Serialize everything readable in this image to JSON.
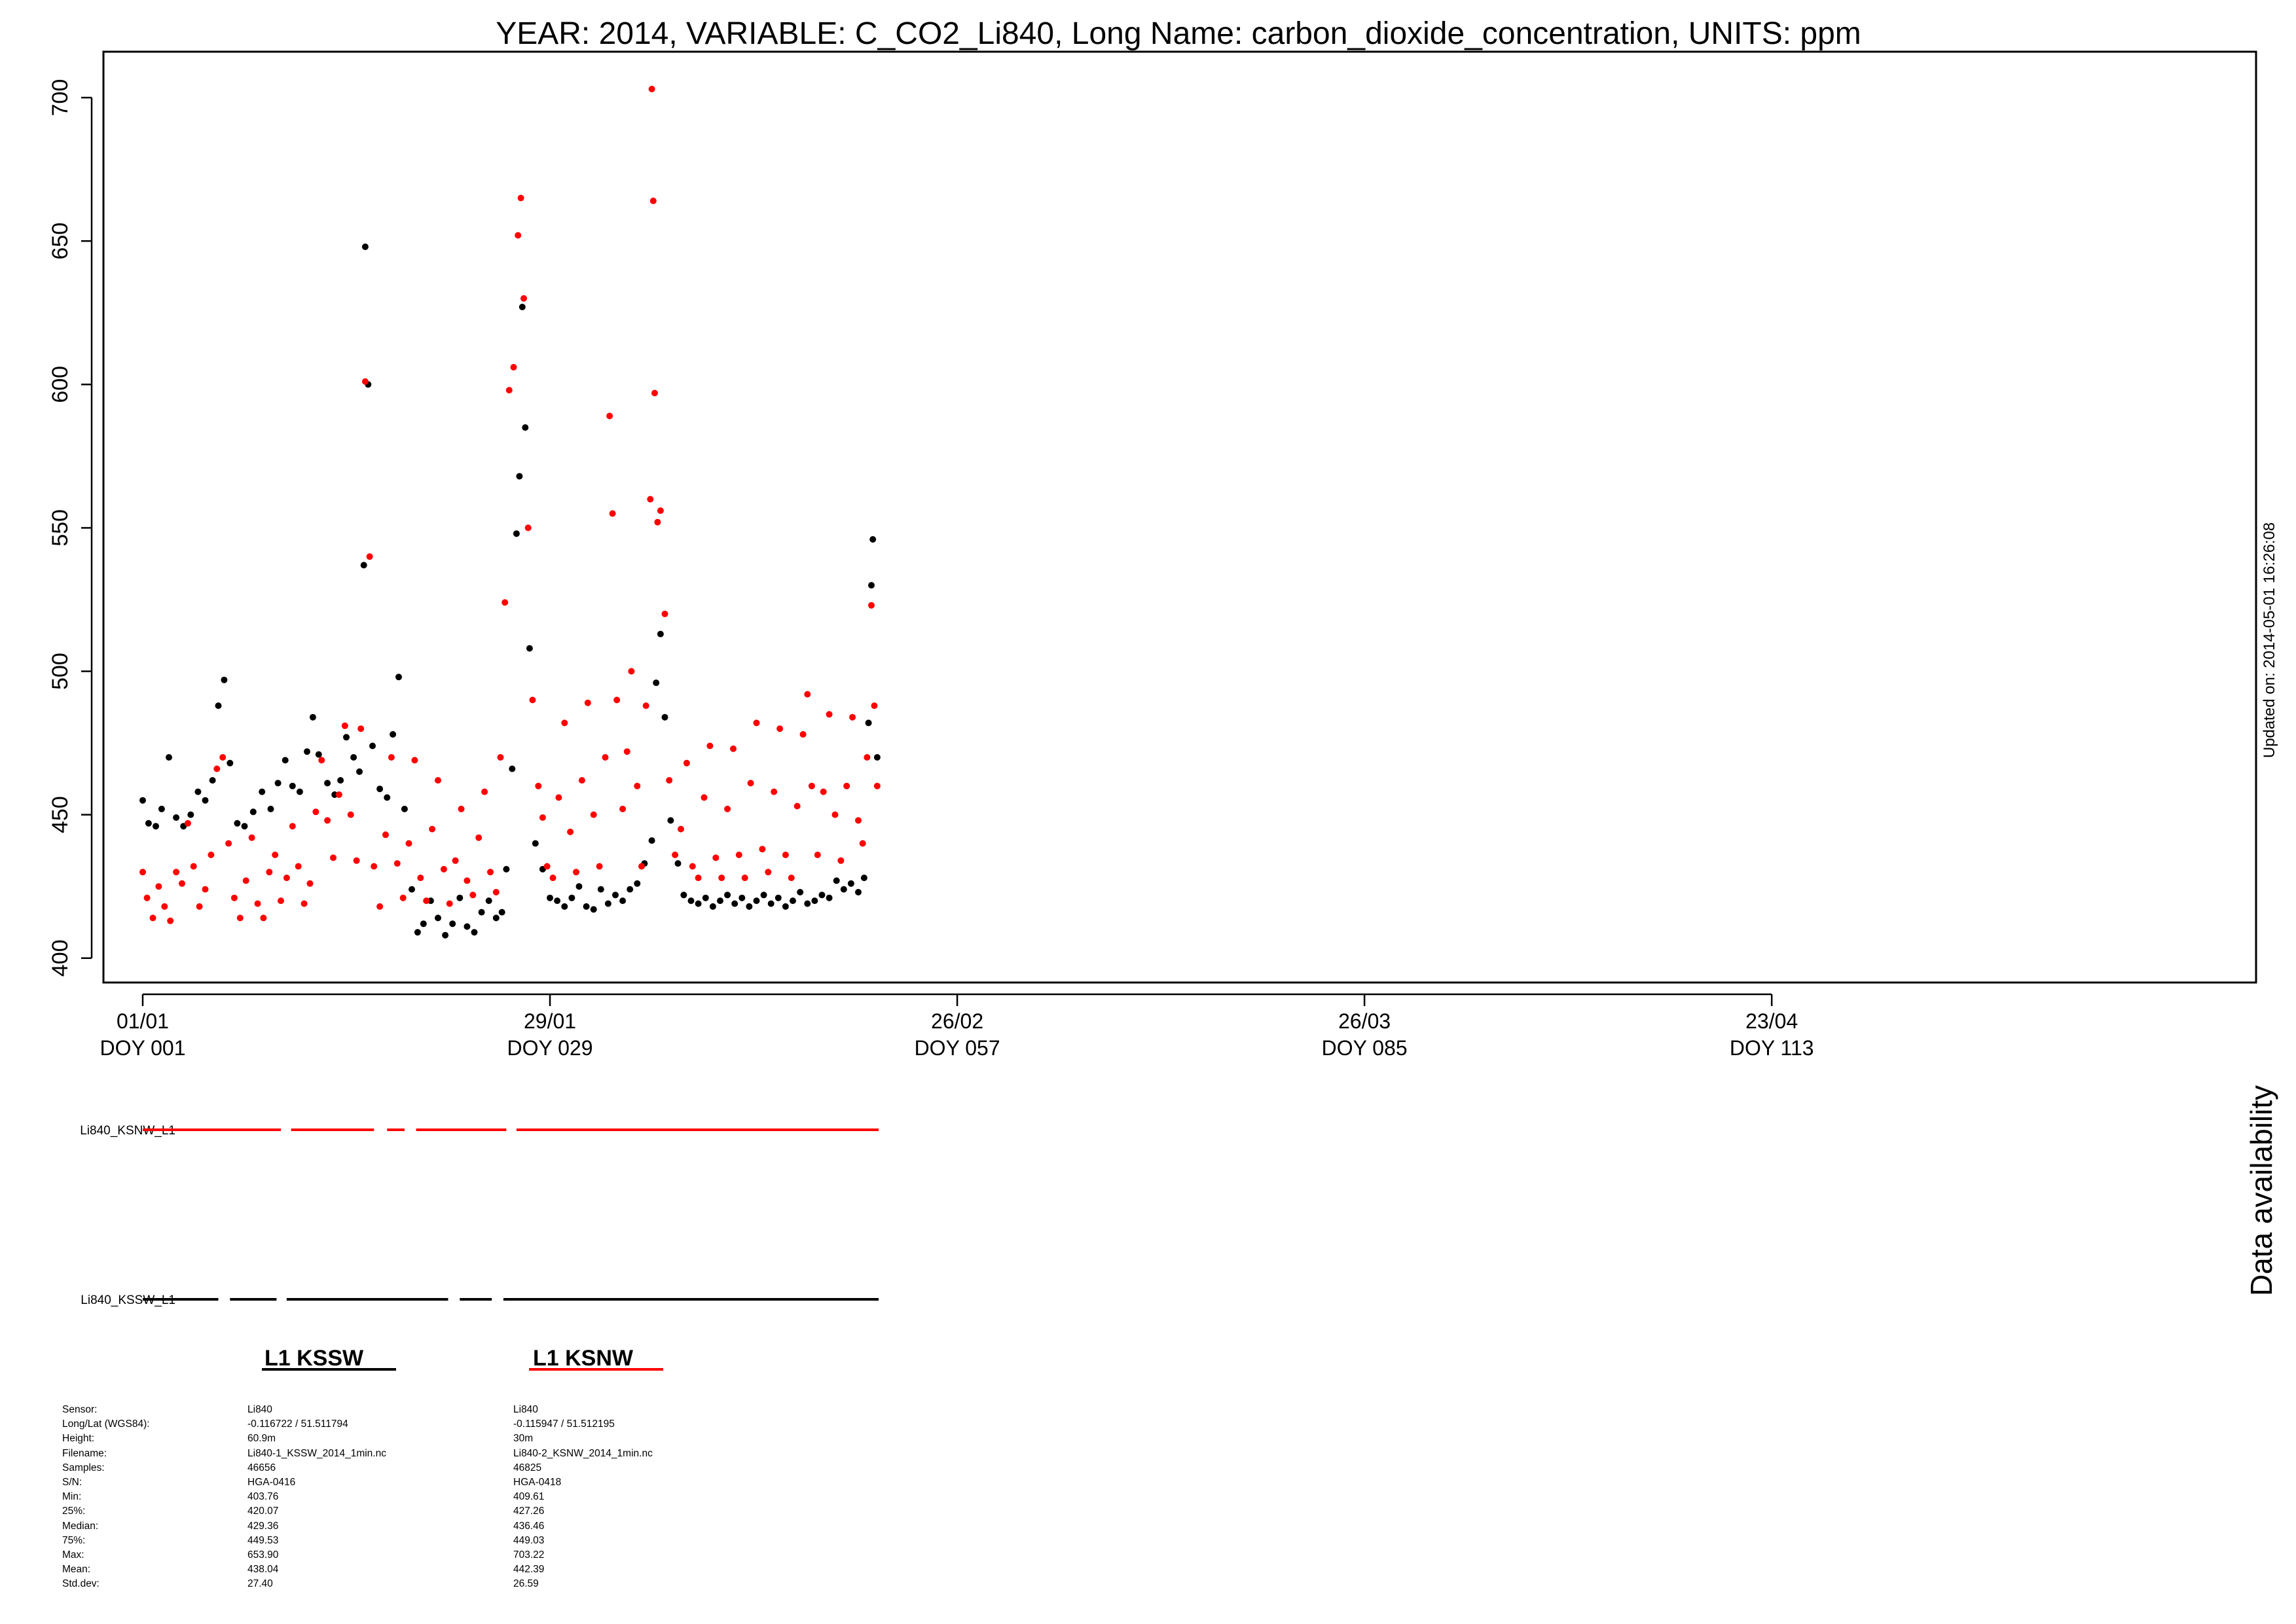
{
  "chart_data": {
    "type": "scatter",
    "title": "YEAR: 2014, VARIABLE: C_CO2_Li840, Long Name: carbon_dioxide_concentration, UNITS: ppm",
    "xlabel": "",
    "ylabel": "",
    "x_axis": {
      "unit": "day of year",
      "range": [
        -1.7,
        146.3
      ],
      "ticks": [
        {
          "doy": 1,
          "date": "01/01",
          "label": "DOY 001"
        },
        {
          "doy": 29,
          "date": "29/01",
          "label": "DOY 029"
        },
        {
          "doy": 57,
          "date": "26/02",
          "label": "DOY 057"
        },
        {
          "doy": 85,
          "date": "26/03",
          "label": "DOY 085"
        },
        {
          "doy": 113,
          "date": "23/04",
          "label": "DOY 113"
        }
      ]
    },
    "y_axis": {
      "range": [
        391.5,
        716
      ],
      "ticks": [
        400,
        450,
        500,
        550,
        600,
        650,
        700
      ]
    },
    "grid": false,
    "series": [
      {
        "name": "L1 KSSW",
        "color": "#000000",
        "points": [
          [
            1.0,
            455
          ],
          [
            1.4,
            447
          ],
          [
            1.9,
            446
          ],
          [
            2.3,
            452
          ],
          [
            2.8,
            470
          ],
          [
            3.3,
            449
          ],
          [
            3.8,
            446
          ],
          [
            4.3,
            450
          ],
          [
            4.8,
            458
          ],
          [
            5.3,
            455
          ],
          [
            5.8,
            462
          ],
          [
            6.2,
            488
          ],
          [
            6.6,
            497
          ],
          [
            7.0,
            468
          ],
          [
            7.5,
            447
          ],
          [
            8.0,
            446
          ],
          [
            8.6,
            451
          ],
          [
            9.2,
            458
          ],
          [
            9.8,
            452
          ],
          [
            10.3,
            461
          ],
          [
            10.8,
            469
          ],
          [
            11.3,
            460
          ],
          [
            11.8,
            458
          ],
          [
            12.3,
            472
          ],
          [
            12.7,
            484
          ],
          [
            13.1,
            471
          ],
          [
            13.7,
            461
          ],
          [
            14.2,
            457
          ],
          [
            14.6,
            462
          ],
          [
            15.0,
            477
          ],
          [
            15.5,
            470
          ],
          [
            15.9,
            465
          ],
          [
            16.2,
            537
          ],
          [
            16.3,
            648
          ],
          [
            16.5,
            600
          ],
          [
            16.8,
            474
          ],
          [
            17.3,
            459
          ],
          [
            17.8,
            456
          ],
          [
            18.2,
            478
          ],
          [
            18.6,
            498
          ],
          [
            19.0,
            452
          ],
          [
            19.5,
            424
          ],
          [
            19.9,
            409
          ],
          [
            20.3,
            412
          ],
          [
            20.8,
            420
          ],
          [
            21.3,
            414
          ],
          [
            21.8,
            408
          ],
          [
            22.3,
            412
          ],
          [
            22.8,
            421
          ],
          [
            23.3,
            411
          ],
          [
            23.8,
            409
          ],
          [
            24.3,
            416
          ],
          [
            24.8,
            420
          ],
          [
            25.3,
            414
          ],
          [
            25.7,
            416
          ],
          [
            26.0,
            431
          ],
          [
            26.4,
            466
          ],
          [
            26.7,
            548
          ],
          [
            26.9,
            568
          ],
          [
            27.1,
            627
          ],
          [
            27.3,
            585
          ],
          [
            27.6,
            508
          ],
          [
            28.0,
            440
          ],
          [
            28.5,
            431
          ],
          [
            29.0,
            421
          ],
          [
            29.5,
            420
          ],
          [
            30.0,
            418
          ],
          [
            30.5,
            421
          ],
          [
            31.0,
            425
          ],
          [
            31.5,
            418
          ],
          [
            32.0,
            417
          ],
          [
            32.5,
            424
          ],
          [
            33.0,
            419
          ],
          [
            33.5,
            422
          ],
          [
            34.0,
            420
          ],
          [
            34.5,
            424
          ],
          [
            35.0,
            426
          ],
          [
            35.5,
            433
          ],
          [
            36.0,
            441
          ],
          [
            36.3,
            496
          ],
          [
            36.6,
            513
          ],
          [
            36.9,
            484
          ],
          [
            37.3,
            448
          ],
          [
            37.8,
            433
          ],
          [
            38.2,
            422
          ],
          [
            38.7,
            420
          ],
          [
            39.2,
            419
          ],
          [
            39.7,
            421
          ],
          [
            40.2,
            418
          ],
          [
            40.7,
            420
          ],
          [
            41.2,
            422
          ],
          [
            41.7,
            419
          ],
          [
            42.2,
            421
          ],
          [
            42.7,
            418
          ],
          [
            43.2,
            420
          ],
          [
            43.7,
            422
          ],
          [
            44.2,
            419
          ],
          [
            44.7,
            421
          ],
          [
            45.2,
            418
          ],
          [
            45.7,
            420
          ],
          [
            46.2,
            423
          ],
          [
            46.7,
            419
          ],
          [
            47.2,
            420
          ],
          [
            47.7,
            422
          ],
          [
            48.2,
            421
          ],
          [
            48.7,
            427
          ],
          [
            49.2,
            424
          ],
          [
            49.7,
            426
          ],
          [
            50.2,
            423
          ],
          [
            50.6,
            428
          ],
          [
            50.9,
            482
          ],
          [
            51.1,
            530
          ],
          [
            51.2,
            546
          ],
          [
            51.5,
            470
          ]
        ]
      },
      {
        "name": "L1 KSNW",
        "color": "#ff0000",
        "points": [
          [
            1.0,
            430
          ],
          [
            1.3,
            421
          ],
          [
            1.7,
            414
          ],
          [
            2.1,
            425
          ],
          [
            2.5,
            418
          ],
          [
            2.9,
            413
          ],
          [
            3.3,
            430
          ],
          [
            3.7,
            426
          ],
          [
            4.1,
            447
          ],
          [
            4.5,
            432
          ],
          [
            4.9,
            418
          ],
          [
            5.3,
            424
          ],
          [
            5.7,
            436
          ],
          [
            6.1,
            466
          ],
          [
            6.5,
            470
          ],
          [
            6.9,
            440
          ],
          [
            7.3,
            421
          ],
          [
            7.7,
            414
          ],
          [
            8.1,
            427
          ],
          [
            8.5,
            442
          ],
          [
            8.9,
            419
          ],
          [
            9.3,
            414
          ],
          [
            9.7,
            430
          ],
          [
            10.1,
            436
          ],
          [
            10.5,
            420
          ],
          [
            10.9,
            428
          ],
          [
            11.3,
            446
          ],
          [
            11.7,
            432
          ],
          [
            12.1,
            419
          ],
          [
            12.5,
            426
          ],
          [
            12.9,
            451
          ],
          [
            13.3,
            469
          ],
          [
            13.7,
            448
          ],
          [
            14.1,
            435
          ],
          [
            14.5,
            457
          ],
          [
            14.9,
            481
          ],
          [
            15.3,
            450
          ],
          [
            15.7,
            434
          ],
          [
            16.0,
            480
          ],
          [
            16.3,
            601
          ],
          [
            16.6,
            540
          ],
          [
            16.9,
            432
          ],
          [
            17.3,
            418
          ],
          [
            17.7,
            443
          ],
          [
            18.1,
            470
          ],
          [
            18.5,
            433
          ],
          [
            18.9,
            421
          ],
          [
            19.3,
            440
          ],
          [
            19.7,
            469
          ],
          [
            20.1,
            428
          ],
          [
            20.5,
            420
          ],
          [
            20.9,
            445
          ],
          [
            21.3,
            462
          ],
          [
            21.7,
            431
          ],
          [
            22.1,
            419
          ],
          [
            22.5,
            434
          ],
          [
            22.9,
            452
          ],
          [
            23.3,
            427
          ],
          [
            23.7,
            422
          ],
          [
            24.1,
            442
          ],
          [
            24.5,
            458
          ],
          [
            24.9,
            430
          ],
          [
            25.3,
            423
          ],
          [
            25.6,
            470
          ],
          [
            25.9,
            524
          ],
          [
            26.2,
            598
          ],
          [
            26.5,
            606
          ],
          [
            26.8,
            652
          ],
          [
            27.0,
            665
          ],
          [
            27.2,
            630
          ],
          [
            27.5,
            550
          ],
          [
            27.8,
            490
          ],
          [
            28.2,
            460
          ],
          [
            28.5,
            449
          ],
          [
            28.8,
            432
          ],
          [
            29.2,
            428
          ],
          [
            29.6,
            456
          ],
          [
            30.0,
            482
          ],
          [
            30.4,
            444
          ],
          [
            30.8,
            430
          ],
          [
            31.2,
            462
          ],
          [
            31.6,
            489
          ],
          [
            32.0,
            450
          ],
          [
            32.4,
            432
          ],
          [
            32.8,
            470
          ],
          [
            33.1,
            589
          ],
          [
            33.3,
            555
          ],
          [
            33.6,
            490
          ],
          [
            34.0,
            452
          ],
          [
            34.3,
            472
          ],
          [
            34.6,
            500
          ],
          [
            35.0,
            460
          ],
          [
            35.3,
            432
          ],
          [
            35.6,
            488
          ],
          [
            35.9,
            560
          ],
          [
            36.0,
            703
          ],
          [
            36.1,
            664
          ],
          [
            36.2,
            597
          ],
          [
            36.4,
            552
          ],
          [
            36.6,
            556
          ],
          [
            36.9,
            520
          ],
          [
            37.2,
            462
          ],
          [
            37.6,
            436
          ],
          [
            38.0,
            445
          ],
          [
            38.4,
            468
          ],
          [
            38.8,
            432
          ],
          [
            39.2,
            428
          ],
          [
            39.6,
            456
          ],
          [
            40.0,
            474
          ],
          [
            40.4,
            435
          ],
          [
            40.8,
            428
          ],
          [
            41.2,
            452
          ],
          [
            41.6,
            473
          ],
          [
            42.0,
            436
          ],
          [
            42.4,
            428
          ],
          [
            42.8,
            461
          ],
          [
            43.2,
            482
          ],
          [
            43.6,
            438
          ],
          [
            44.0,
            430
          ],
          [
            44.4,
            458
          ],
          [
            44.8,
            480
          ],
          [
            45.2,
            436
          ],
          [
            45.6,
            428
          ],
          [
            46.0,
            453
          ],
          [
            46.4,
            478
          ],
          [
            46.7,
            492
          ],
          [
            47.0,
            460
          ],
          [
            47.4,
            436
          ],
          [
            47.8,
            458
          ],
          [
            48.2,
            485
          ],
          [
            48.6,
            450
          ],
          [
            49.0,
            434
          ],
          [
            49.4,
            460
          ],
          [
            49.8,
            484
          ],
          [
            50.2,
            448
          ],
          [
            50.5,
            440
          ],
          [
            50.8,
            470
          ],
          [
            51.1,
            523
          ],
          [
            51.3,
            488
          ],
          [
            51.5,
            460
          ]
        ]
      }
    ],
    "availability": {
      "title": "Data availability",
      "tracks": [
        {
          "label": "Li840_KSNW_L1",
          "color": "#ff0000",
          "segments": [
            [
              1.0,
              10.5
            ],
            [
              11.2,
              16.9
            ],
            [
              17.8,
              19.0
            ],
            [
              19.8,
              26.0
            ],
            [
              26.7,
              51.6
            ]
          ]
        },
        {
          "label": "Li840_KSSW_L1",
          "color": "#000000",
          "segments": [
            [
              1.0,
              6.2
            ],
            [
              7.0,
              10.2
            ],
            [
              10.9,
              22.0
            ],
            [
              22.8,
              25.0
            ],
            [
              25.8,
              51.6
            ]
          ]
        }
      ]
    }
  },
  "side_note": "Updated on: 2014-05-01 16:26:08",
  "info": {
    "labels": [
      "Sensor:",
      "Long/Lat (WGS84):",
      "Height:",
      "Filename:",
      "Samples:",
      "S/N:",
      "Min:",
      "25%:",
      "Median:",
      "75%:",
      "Max:",
      "Mean:",
      "Std.dev:"
    ],
    "sensors": [
      {
        "title": "L1 KSSW",
        "color": "#000000",
        "values": [
          "Li840",
          "-0.116722 / 51.511794",
          "60.9m",
          "Li840-1_KSSW_2014_1min.nc",
          "46656",
          "HGA-0416",
          "403.76",
          "420.07",
          "429.36",
          "449.53",
          "653.90",
          "438.04",
          "27.40"
        ]
      },
      {
        "title": "L1 KSNW",
        "color": "#ff0000",
        "values": [
          "Li840",
          "-0.115947 / 51.512195",
          "30m",
          "Li840-2_KSNW_2014_1min.nc",
          "46825",
          "HGA-0418",
          "409.61",
          "427.26",
          "436.46",
          "449.03",
          "703.22",
          "442.39",
          "26.59"
        ]
      }
    ]
  }
}
